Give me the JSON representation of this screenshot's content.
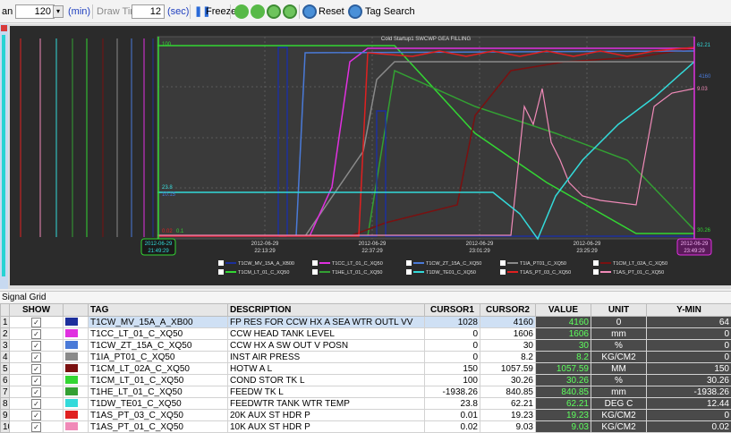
{
  "toolbar": {
    "span_label": "an",
    "span_value": "120",
    "span_unit": "(min)",
    "draw_time_label": "Draw Time",
    "draw_time_value": "12",
    "draw_time_unit": "(sec)",
    "freeze_label": "Freeze",
    "reset_label": "Reset",
    "tag_search_label": "Tag Search"
  },
  "chart": {
    "title": "Cold Startup1 SWCWP GEA FILLING",
    "cursor_start_date": "2012-06-29",
    "cursor_start_time": "21:49:29",
    "cursor_end_date": "2012-06-29",
    "cursor_end_time": "23:49:29",
    "ticks": [
      {
        "date": "2012-06-29",
        "time": "22:13:29"
      },
      {
        "date": "2012-06-29",
        "time": "22:37:29"
      },
      {
        "date": "2012-06-29",
        "time": "23:01:29"
      },
      {
        "date": "2012-06-29",
        "time": "23:25:29"
      }
    ],
    "left_value_labels": [
      "100",
      "23.8",
      "10.15",
      "0.02",
      "0.1"
    ],
    "right_value_labels": [
      "62.21",
      "4160",
      "9.03",
      "30.26"
    ],
    "legend": [
      [
        "T1CW_MV_15A_A_XB00",
        "T1CC_LT_01_C_XQ50",
        "T1CW_ZT_15A_C_XQ50",
        "T1IA_PT01_C_XQ50",
        "T1CM_LT_02A_C_XQ50"
      ],
      [
        "T1CM_LT_01_C_XQ50",
        "T1HE_LT_01_C_XQ50",
        "T1DW_TE01_C_XQ50",
        "T1AS_PT_03_C_XQ50",
        "T1AS_PT_01_C_XQ50"
      ]
    ],
    "colors": {
      "bg": "#2b2b2b",
      "series": [
        "#1c2f9c",
        "#e030e0",
        "#4a7ad8",
        "#8a8a8a",
        "#7a1010",
        "#33d633",
        "#33a033",
        "#33dada",
        "#e02020",
        "#f08ab8"
      ]
    }
  },
  "grid": {
    "title": "Signal Grid",
    "headers": [
      "SHOW",
      "",
      "TAG",
      "DESCRIPTION",
      "CURSOR1",
      "CURSOR2",
      "VALUE",
      "UNIT",
      "Y-MIN"
    ],
    "rows": [
      {
        "n": "1",
        "tag": "T1CW_MV_15A_A_XB00",
        "desc": "FP RES FOR CCW HX A SEA WTR OUTL VV",
        "c1": "1028",
        "c2": "4160",
        "val": "4160",
        "unit": "0",
        "ymin": "64",
        "color": "#1c2f9c"
      },
      {
        "n": "2",
        "tag": "T1CC_LT_01_C_XQ50",
        "desc": "CCW HEAD TANK LEVEL",
        "c1": "0",
        "c2": "1606",
        "val": "1606",
        "unit": "mm",
        "ymin": "0",
        "color": "#e030e0"
      },
      {
        "n": "3",
        "tag": "T1CW_ZT_15A_C_XQ50",
        "desc": "CCW HX A SW OUT V POSN",
        "c1": "0",
        "c2": "30",
        "val": "30",
        "unit": "%",
        "ymin": "0",
        "color": "#4a7ad8"
      },
      {
        "n": "4",
        "tag": "T1IA_PT01_C_XQ50",
        "desc": "INST AIR PRESS",
        "c1": "0",
        "c2": "8.2",
        "val": "8.2",
        "unit": "KG/CM2",
        "ymin": "0",
        "color": "#8a8a8a"
      },
      {
        "n": "5",
        "tag": "T1CM_LT_02A_C_XQ50",
        "desc": "HOTW A L",
        "c1": "150",
        "c2": "1057.59",
        "val": "1057.59",
        "unit": "MM",
        "ymin": "150",
        "color": "#7a1010"
      },
      {
        "n": "6",
        "tag": "T1CM_LT_01_C_XQ50",
        "desc": "COND STOR TK L",
        "c1": "100",
        "c2": "30.26",
        "val": "30.26",
        "unit": "%",
        "ymin": "30.26",
        "color": "#33d633"
      },
      {
        "n": "7",
        "tag": "T1HE_LT_01_C_XQ50",
        "desc": "FEEDW TK L",
        "c1": "-1938.26",
        "c2": "840.85",
        "val": "840.85",
        "unit": "mm",
        "ymin": "-1938.26",
        "color": "#33a033"
      },
      {
        "n": "8",
        "tag": "T1DW_TE01_C_XQ50",
        "desc": "FEEDWTR TANK WTR TEMP",
        "c1": "23.8",
        "c2": "62.21",
        "val": "62.21",
        "unit": "DEG C",
        "ymin": "12.44",
        "color": "#33dada"
      },
      {
        "n": "9",
        "tag": "T1AS_PT_03_C_XQ50",
        "desc": "20K AUX ST HDR P",
        "c1": "0.01",
        "c2": "19.23",
        "val": "19.23",
        "unit": "KG/CM2",
        "ymin": "0",
        "color": "#e02020"
      },
      {
        "n": "10",
        "tag": "T1AS_PT_01_C_XQ50",
        "desc": "10K AUX ST HDR P",
        "c1": "0.02",
        "c2": "9.03",
        "val": "9.03",
        "unit": "KG/CM2",
        "ymin": "0.02",
        "color": "#f08ab8"
      }
    ]
  }
}
